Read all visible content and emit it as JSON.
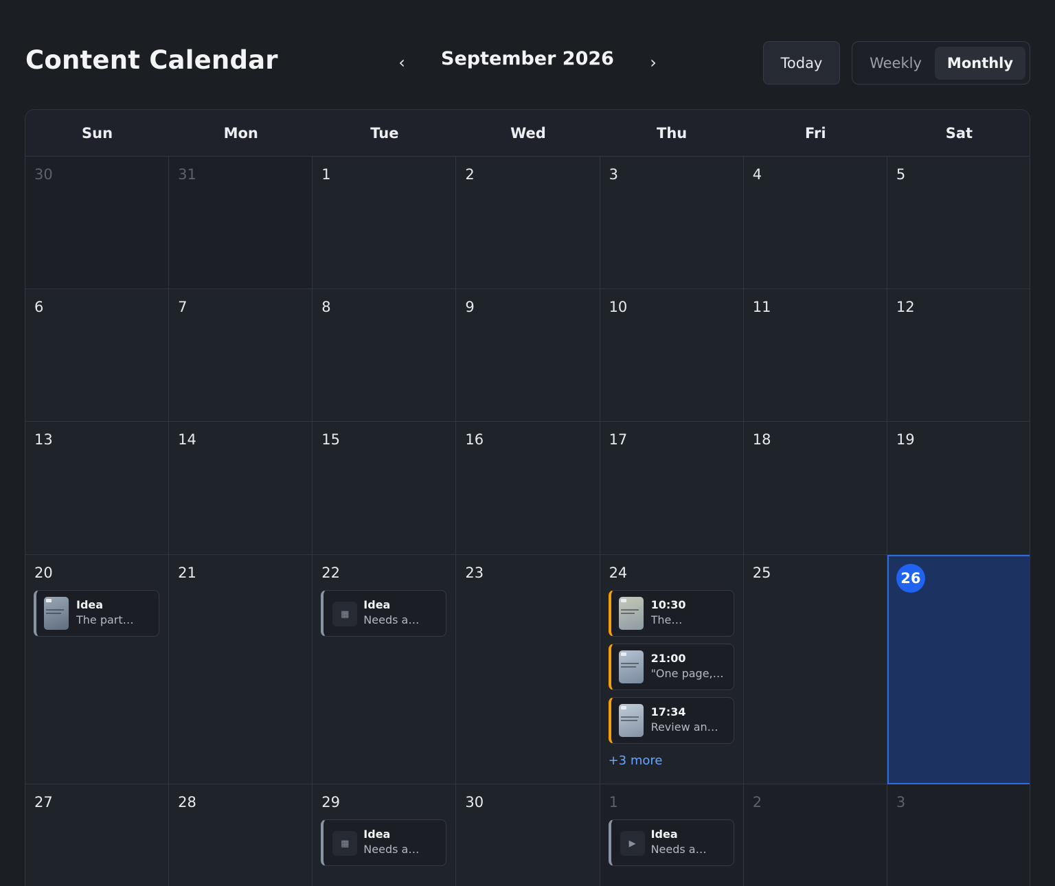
{
  "header": {
    "title": "Content Calendar",
    "prev_icon": "‹",
    "next_icon": "›",
    "month_label": "September 2026",
    "today_label": "Today",
    "views": {
      "weekly": "Weekly",
      "monthly": "Monthly",
      "active": "Monthly"
    }
  },
  "weekdays": [
    "Sun",
    "Mon",
    "Tue",
    "Wed",
    "Thu",
    "Fri",
    "Sat"
  ],
  "colors": {
    "idea_accent": "#8a93a3",
    "scheduled_accent": "#f59e0b",
    "today_highlight": "#1f63f0",
    "link": "#6aa5ff"
  },
  "weeks": [
    {
      "days": [
        "30",
        "31",
        "1",
        "2",
        "3",
        "4",
        "5"
      ]
    },
    {
      "days": [
        "6",
        "7",
        "8",
        "9",
        "10",
        "11",
        "12"
      ]
    },
    {
      "days": [
        "13",
        "14",
        "15",
        "16",
        "17",
        "18",
        "19"
      ]
    },
    {
      "days": [
        "20",
        "21",
        "22",
        "23",
        "24",
        "25",
        "26"
      ]
    },
    {
      "days": [
        "27",
        "28",
        "29",
        "30",
        "1",
        "2",
        "3"
      ]
    }
  ],
  "events": {
    "sep20": [
      {
        "title": "Idea",
        "subtitle": "The part…",
        "type": "idea",
        "media": "image-thumbnail"
      }
    ],
    "sep22": [
      {
        "title": "Idea",
        "subtitle": "Needs a…",
        "type": "idea",
        "media": "image-placeholder-icon"
      }
    ],
    "sep24": [
      {
        "title": "10:30",
        "subtitle": "The…",
        "type": "scheduled",
        "media": "image-thumbnail"
      },
      {
        "title": "21:00",
        "subtitle": "\"One page,…",
        "type": "scheduled",
        "media": "image-thumbnail"
      },
      {
        "title": "17:34",
        "subtitle": "Review an…",
        "type": "scheduled",
        "media": "image-thumbnail"
      }
    ],
    "sep24_more": "+3 more",
    "sep29": [
      {
        "title": "Idea",
        "subtitle": "Needs a…",
        "type": "idea",
        "media": "image-placeholder-icon"
      }
    ],
    "oct1": [
      {
        "title": "Idea",
        "subtitle": "Needs a…",
        "type": "idea",
        "media": "video-placeholder-icon"
      }
    ]
  },
  "icons": {
    "image_placeholder": "▦",
    "video_placeholder": "▶"
  }
}
